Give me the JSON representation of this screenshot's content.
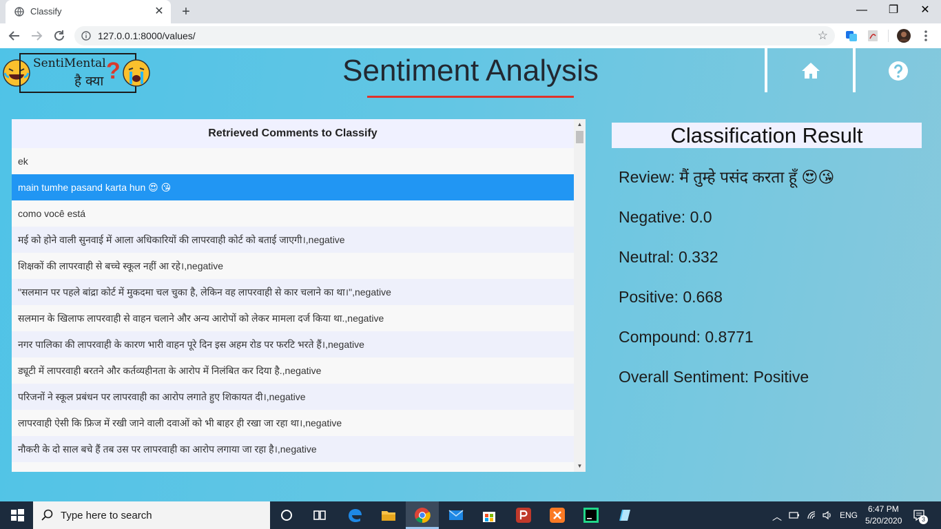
{
  "browser": {
    "tab_title": "Classify",
    "url": "127.0.0.1:8000/values/"
  },
  "header": {
    "logo_text_en": "SentiMental",
    "logo_text_hi": "है क्या",
    "logo_question": "?",
    "title": "Sentiment Analysis",
    "nav": [
      "home-icon",
      "help-icon"
    ]
  },
  "comments": {
    "heading": "Retrieved Comments to Classify",
    "selected_index": 1,
    "items": [
      "ek",
      "main tumhe pasand karta hun 😍 😘",
      "como você está",
      "मई को होने वाली सुनवाई में आला अधिकारियों की लापरवाही कोर्ट को बताई जाएगी।,negative",
      "शिक्षकों की लापरवाही से बच्चे स्कूल नहीं आ रहे।,negative",
      "\"सलमान पर पहले बांद्रा कोर्ट में मुकदमा चल चुका है, लेकिन वह लापरवाही से कार चलाने का था।\",negative",
      "सलमान के खिलाफ लापरवाही से वाहन चलाने और अन्य आरोपों को लेकर मामला दर्ज किया था.,negative",
      "नगर पालिका की लापरवाही के कारण भारी वाहन पूरे दिन इस अहम रोड पर फरटि भरते हैं।,negative",
      "ड्यूटी में लापरवाही बरतने और कर्तव्यहीनता के आरोप में निलंबित कर दिया है.,negative",
      "परिजनों ने स्कूल प्रबंधन पर लापरवाही का आरोप लगाते हुए शिकायत दी।,negative",
      "लापरवाही ऐसी कि फ्रिज में रखी जाने वाली दवाओं को भी बाहर ही रखा जा रहा था।,negative",
      "नौकरी के दो साल बचे हैं तब उस पर लापरवाही का आरोप लगाया जा रहा है।,negative",
      "…"
    ]
  },
  "result": {
    "heading": "Classification Result",
    "review_label": "Review:",
    "review_value": "मैं तुम्हे पसंद करता हूँ 😍😘",
    "negative_label": "Negative:",
    "negative_value": "0.0",
    "neutral_label": "Neutral:",
    "neutral_value": "0.332",
    "positive_label": "Positive:",
    "positive_value": "0.668",
    "compound_label": "Compound:",
    "compound_value": "0.8771",
    "overall_label": "Overall Sentiment:",
    "overall_value": "Positive"
  },
  "taskbar": {
    "search_placeholder": "Type here to search",
    "time": "6:47 PM",
    "date": "5/20/2020",
    "language": "ENG",
    "notifications": "3"
  }
}
